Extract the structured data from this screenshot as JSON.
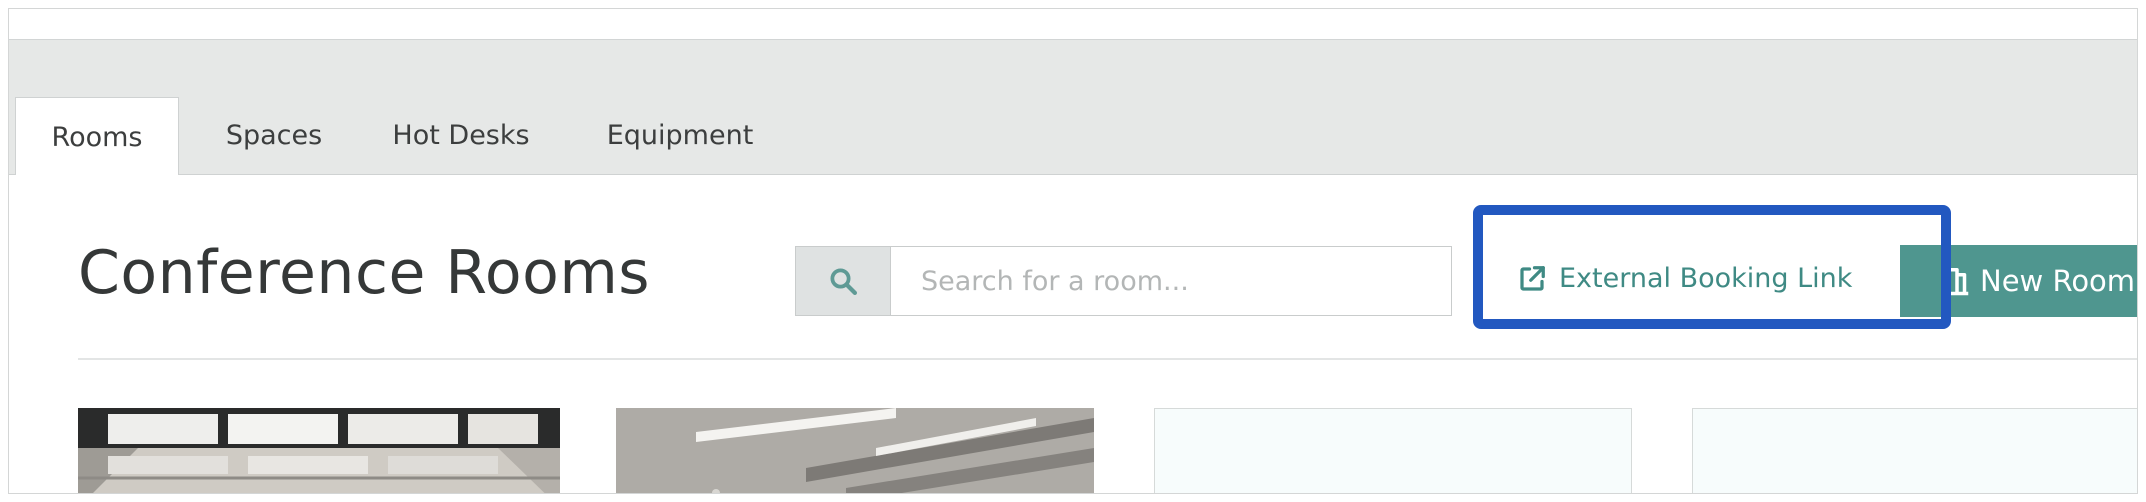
{
  "tabs": [
    {
      "label": "Rooms",
      "active": true
    },
    {
      "label": "Spaces",
      "active": false
    },
    {
      "label": "Hot Desks",
      "active": false
    },
    {
      "label": "Equipment",
      "active": false
    }
  ],
  "page": {
    "title": "Conference Rooms"
  },
  "search": {
    "placeholder": "Search for a room...",
    "value": "",
    "icon": "search-icon"
  },
  "actions": {
    "external_booking_label": "External Booking Link",
    "external_booking_icon": "external-link-icon",
    "new_room_label": "New Room",
    "new_room_icon": "new-room-icon"
  },
  "colors": {
    "accent": "#4f968f",
    "link": "#3f8a84",
    "highlight": "#2258c0"
  },
  "room_cards": [
    {
      "image": "room-photo-1"
    },
    {
      "image": "room-photo-2"
    },
    {
      "image": "placeholder"
    },
    {
      "image": "placeholder"
    }
  ]
}
